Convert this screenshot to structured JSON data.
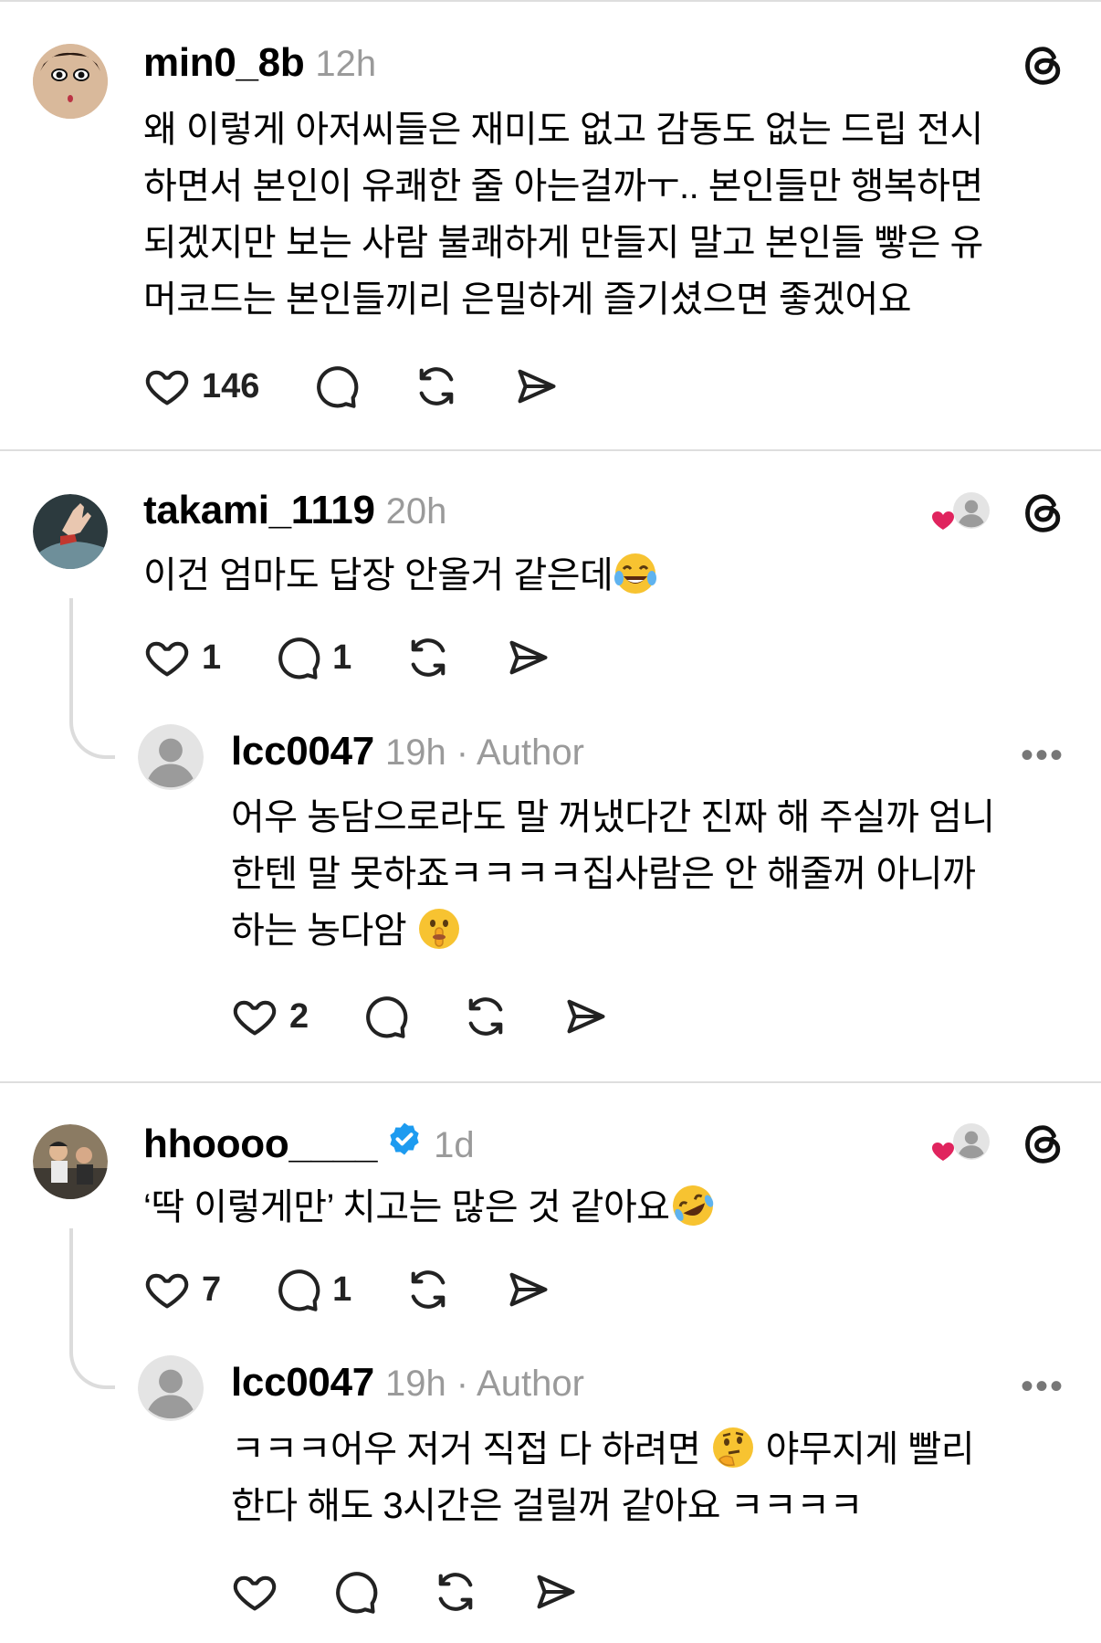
{
  "posts": [
    {
      "username": "min0_8b",
      "time": "12h",
      "lines": [
        "왜 이렇게 아저씨들은  재미도 없고 감동도 없는 드립 전시",
        "하면서 본인이 유쾌한 줄 아는걸까ㅜ.. 본인들만 행복하면",
        "되겠지만 보는 사람 불쾌하게 만들지 말고 본인들 빻은 유",
        "머코드는 본인들끼리 은밀하게 즐기셨으면 좋겠어요"
      ],
      "likes": "146"
    },
    {
      "username": "takami_1119",
      "time": "20h",
      "text": "이건 엄마도 답장 안올거 같은데",
      "emoji_icon": "laughing-crying-emoji",
      "likes": "1",
      "replies": "1",
      "reply": {
        "username": "lcc0047",
        "meta": "19h · Author",
        "lines": [
          "어우 농담으로라도 말 꺼냈다간 진짜 해 주실까 엄니",
          "한텐 말 못하죠ㅋㅋㅋㅋ집사람은 안 해줄꺼 아니까",
          "하는 농다암"
        ],
        "emoji_icon": "shushing-face-emoji",
        "likes": "2"
      }
    },
    {
      "username": "hhoooo____",
      "time": "1d",
      "text": "‘딱 이렇게만’ 치고는 많은 것 같아요",
      "emoji_icon": "rolling-laughing-emoji",
      "likes": "7",
      "replies": "1",
      "reply": {
        "username": "lcc0047",
        "meta": "19h · Author",
        "line1a": "ㅋㅋㅋ어우 저거 직접 다 하려면 ",
        "line1b": " 야무지게 빨리",
        "line2": "한다 해도 3시간은 걸릴꺼 같아요 ㅋㅋㅋㅋ",
        "emoji_icon": "thinking-face-emoji"
      }
    }
  ],
  "more_label": "•••",
  "colors": {
    "verified": "#1d9bf0",
    "heart": "#e0245e"
  }
}
